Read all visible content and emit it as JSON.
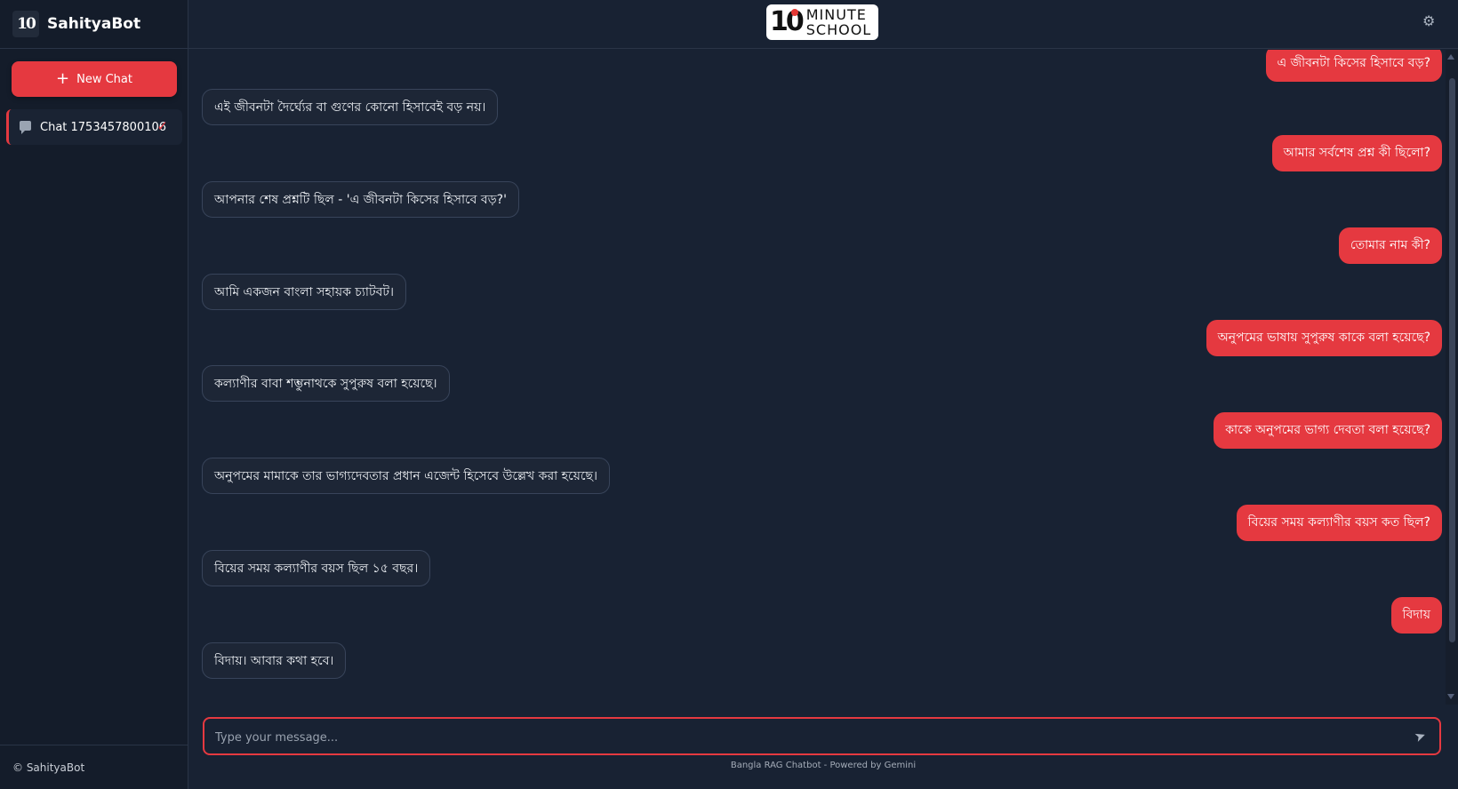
{
  "sidebar": {
    "brand_name": "SahityaBot",
    "brand_logo_text": "10",
    "new_chat_label": "New Chat",
    "chats": [
      {
        "title": "Chat 1753457800106",
        "active": true
      }
    ],
    "footer": "© SahityaBot"
  },
  "header": {
    "logo_number": "10",
    "logo_line1": "MINUTE",
    "logo_line2": "SCHOOL"
  },
  "messages": [
    {
      "role": "user",
      "text": "এ জীবনটা কিসের হিসাবে বড়?"
    },
    {
      "role": "bot",
      "text": "এই জীবনটা দৈর্ঘ্যের বা গুণের কোনো হিসাবেই বড় নয়।"
    },
    {
      "role": "user",
      "text": "আমার সর্বশেষ প্রশ্ন কী ছিলো?"
    },
    {
      "role": "bot",
      "text": "আপনার শেষ প্রশ্নটি ছিল - 'এ জীবনটা কিসের হিসাবে বড়?'"
    },
    {
      "role": "user",
      "text": "তোমার নাম কী?"
    },
    {
      "role": "bot",
      "text": "আমি একজন বাংলা সহায়ক চ্যাটবট।"
    },
    {
      "role": "user",
      "text": "অনুপমের ভাষায় সুপুরুষ কাকে বলা হয়েছে?"
    },
    {
      "role": "bot",
      "text": "কল্যাণীর বাবা শম্ভুনাথকে সুপুরুষ বলা হয়েছে।"
    },
    {
      "role": "user",
      "text": "কাকে অনুপমের ভাগ্য দেবতা বলা হয়েছে?"
    },
    {
      "role": "bot",
      "text": "অনুপমের মামাকে তার ভাগ্যদেবতার প্রধান এজেন্ট হিসেবে উল্লেখ করা হয়েছে।"
    },
    {
      "role": "user",
      "text": "বিয়ের সময় কল্যাণীর বয়স কত ছিল?"
    },
    {
      "role": "bot",
      "text": "বিয়ের সময় কল্যাণীর বয়স ছিল ১৫ বছর।"
    },
    {
      "role": "user",
      "text": "বিদায়"
    },
    {
      "role": "bot",
      "text": "বিদায়। আবার কথা হবে।"
    }
  ],
  "input": {
    "placeholder": "Type your message...",
    "value": ""
  },
  "footer_text": "Bangla RAG Chatbot - Powered by Gemini",
  "colors": {
    "accent": "#e53940",
    "background": "#182233",
    "sidebar": "#141c2a",
    "bot_bubble": "#1d2636"
  }
}
